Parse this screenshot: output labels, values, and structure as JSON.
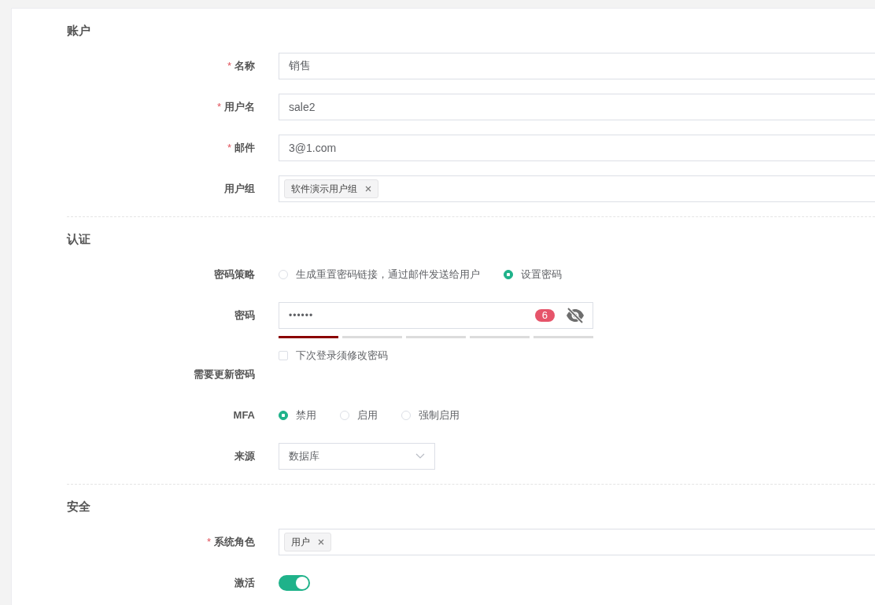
{
  "sections": [
    {
      "title": "账户",
      "fields": [
        {
          "kind": "input",
          "label": "名称",
          "required_mark": "*",
          "value": "销售"
        },
        {
          "kind": "input",
          "label": "用户名",
          "required_mark": "*",
          "value": "sale2"
        },
        {
          "kind": "input",
          "label": "邮件",
          "required_mark": "*",
          "value": "3@1.com"
        },
        {
          "kind": "tags",
          "label": "用户组",
          "tags": [
            "软件演示用户组"
          ]
        }
      ]
    },
    {
      "title": "认证",
      "fields": [
        {
          "kind": "radio",
          "label": "密码策略",
          "options": [
            {
              "label": "生成重置密码链接，通过邮件发送给用户",
              "selected": false
            },
            {
              "label": "设置密码",
              "selected": true
            }
          ]
        },
        {
          "kind": "password",
          "label": "密码",
          "value": "••••••",
          "count": "6",
          "strength": {
            "level": 0.2
          }
        },
        {
          "kind": "checkbox",
          "label": "需要更新密码",
          "option": "下次登录须修改密码",
          "checked": false
        },
        {
          "kind": "radio",
          "label": "MFA",
          "options": [
            {
              "label": "禁用",
              "selected": true
            },
            {
              "label": "启用",
              "selected": false
            },
            {
              "label": "强制启用",
              "selected": false
            }
          ]
        },
        {
          "kind": "select",
          "label": "来源",
          "value": "数据库"
        }
      ]
    },
    {
      "title": "安全",
      "fields": [
        {
          "kind": "tags",
          "label": "系统角色",
          "required_mark": "*",
          "tags": [
            "用户"
          ]
        },
        {
          "kind": "switch",
          "label": "激活",
          "on": true
        }
      ]
    }
  ]
}
